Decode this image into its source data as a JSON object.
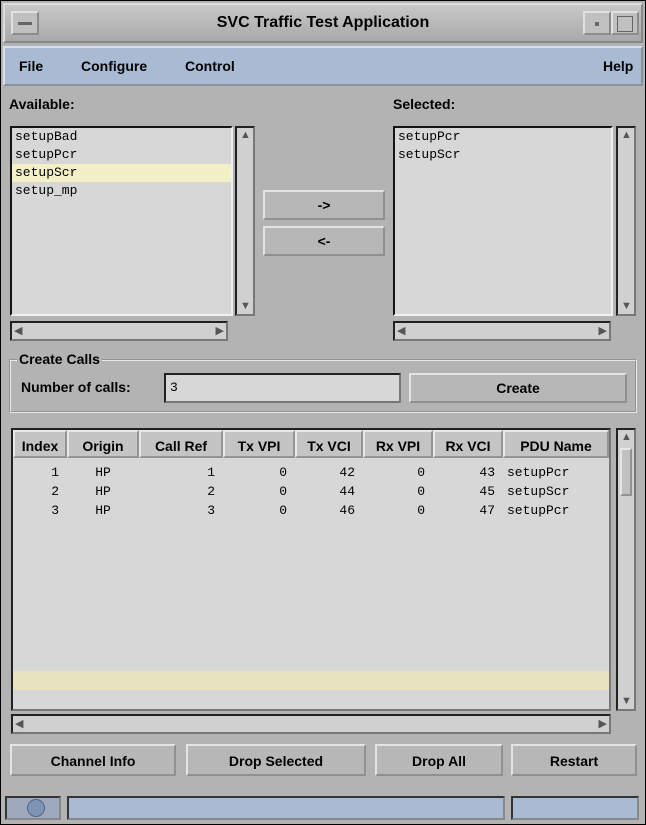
{
  "window": {
    "title": "SVC Traffic Test Application"
  },
  "menu": {
    "file": "File",
    "configure": "Configure",
    "control": "Control",
    "help": "Help"
  },
  "available": {
    "label": "Available:",
    "items": [
      "setupBad",
      "setupPcr",
      "setupScr",
      "setup_mp"
    ],
    "highlighted_index": 2
  },
  "selected": {
    "label": "Selected:",
    "items": [
      "setupPcr",
      "setupScr"
    ]
  },
  "move": {
    "add_label": "->",
    "remove_label": "<-"
  },
  "create_calls": {
    "group_label": "Create Calls",
    "number_label": "Number of calls:",
    "number_value": "3",
    "create_label": "Create"
  },
  "table": {
    "columns": [
      "Index",
      "Origin",
      "Call Ref",
      "Tx VPI",
      "Tx VCI",
      "Rx VPI",
      "Rx VCI",
      "PDU Name"
    ],
    "rows": [
      [
        "1",
        "HP",
        "1",
        "0",
        "42",
        "0",
        "43",
        "setupPcr"
      ],
      [
        "2",
        "HP",
        "2",
        "0",
        "44",
        "0",
        "45",
        "setupScr"
      ],
      [
        "3",
        "HP",
        "3",
        "0",
        "46",
        "0",
        "47",
        "setupPcr"
      ]
    ]
  },
  "actions": {
    "channel_info": "Channel Info",
    "drop_selected": "Drop Selected",
    "drop_all": "Drop All",
    "restart": "Restart"
  },
  "colors": {
    "window_bg": "#b3b3b3",
    "menubar_bg": "#a9bad3",
    "list_bg": "#d7d7d7",
    "highlight": "#f3f0c8"
  }
}
